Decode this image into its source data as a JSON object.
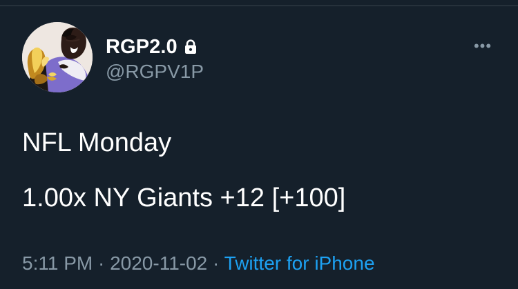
{
  "colors": {
    "background": "#15202b",
    "primary_text": "#ffffff",
    "secondary_text": "#8899a6",
    "link": "#1da1f2",
    "divider": "#38444d"
  },
  "tweet": {
    "author": {
      "name": "RGP2.0",
      "handle": "@RGPV1P",
      "protected_icon": "lock-icon",
      "avatar_icon": "profile-photo-icon"
    },
    "more_label": "•••",
    "text_lines": [
      "NFL Monday",
      "1.00x NY Giants +12 [+100]"
    ],
    "meta": {
      "time": "5:11 PM",
      "separator_1": " · ",
      "date": "2020-11-02",
      "separator_2": " · ",
      "source": "Twitter for iPhone"
    }
  }
}
